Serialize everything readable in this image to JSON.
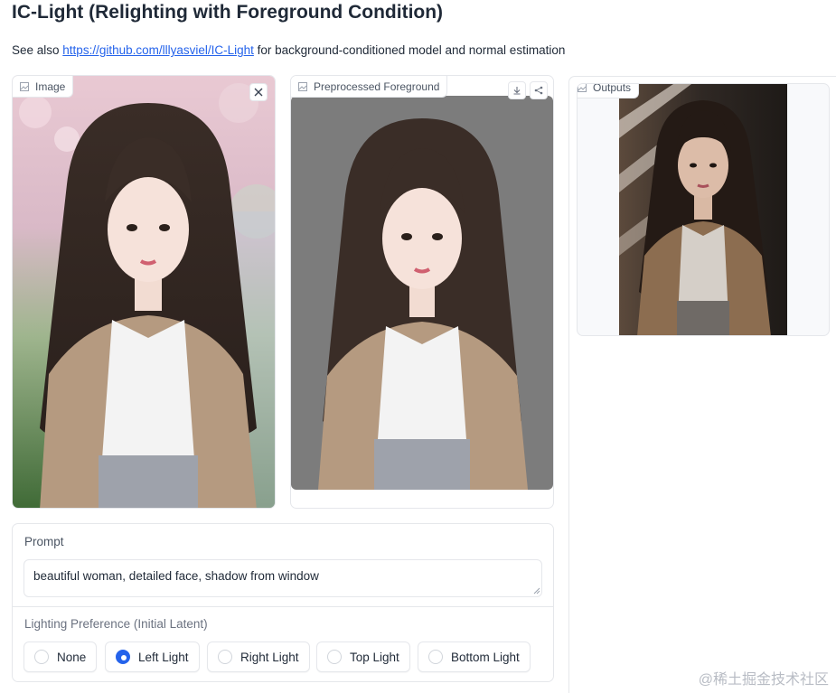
{
  "header": {
    "title": "IC-Light (Relighting with Foreground Condition)",
    "see_also_prefix": "See also ",
    "link_text": "https://github.com/lllyasviel/IC-Light",
    "see_also_suffix": " for background-conditioned model and normal estimation"
  },
  "image_panel": {
    "label": "Image",
    "icon": "image-icon",
    "close_icon": "close-icon"
  },
  "preprocessed_panel": {
    "label": "Preprocessed Foreground",
    "icon": "image-icon",
    "download_icon": "download-icon",
    "share_icon": "share-icon"
  },
  "outputs_panel": {
    "label": "Outputs",
    "icon": "image-icon"
  },
  "prompt": {
    "label": "Prompt",
    "value": "beautiful woman, detailed face, shadow from window"
  },
  "lighting": {
    "label": "Lighting Preference (Initial Latent)",
    "options": [
      "None",
      "Left Light",
      "Right Light",
      "Top Light",
      "Bottom Light"
    ],
    "selected": "Left Light"
  },
  "colors": {
    "accent": "#2563eb",
    "border": "#e5e7eb",
    "text": "#1f2937"
  },
  "watermark": "@稀土掘金技术社区"
}
